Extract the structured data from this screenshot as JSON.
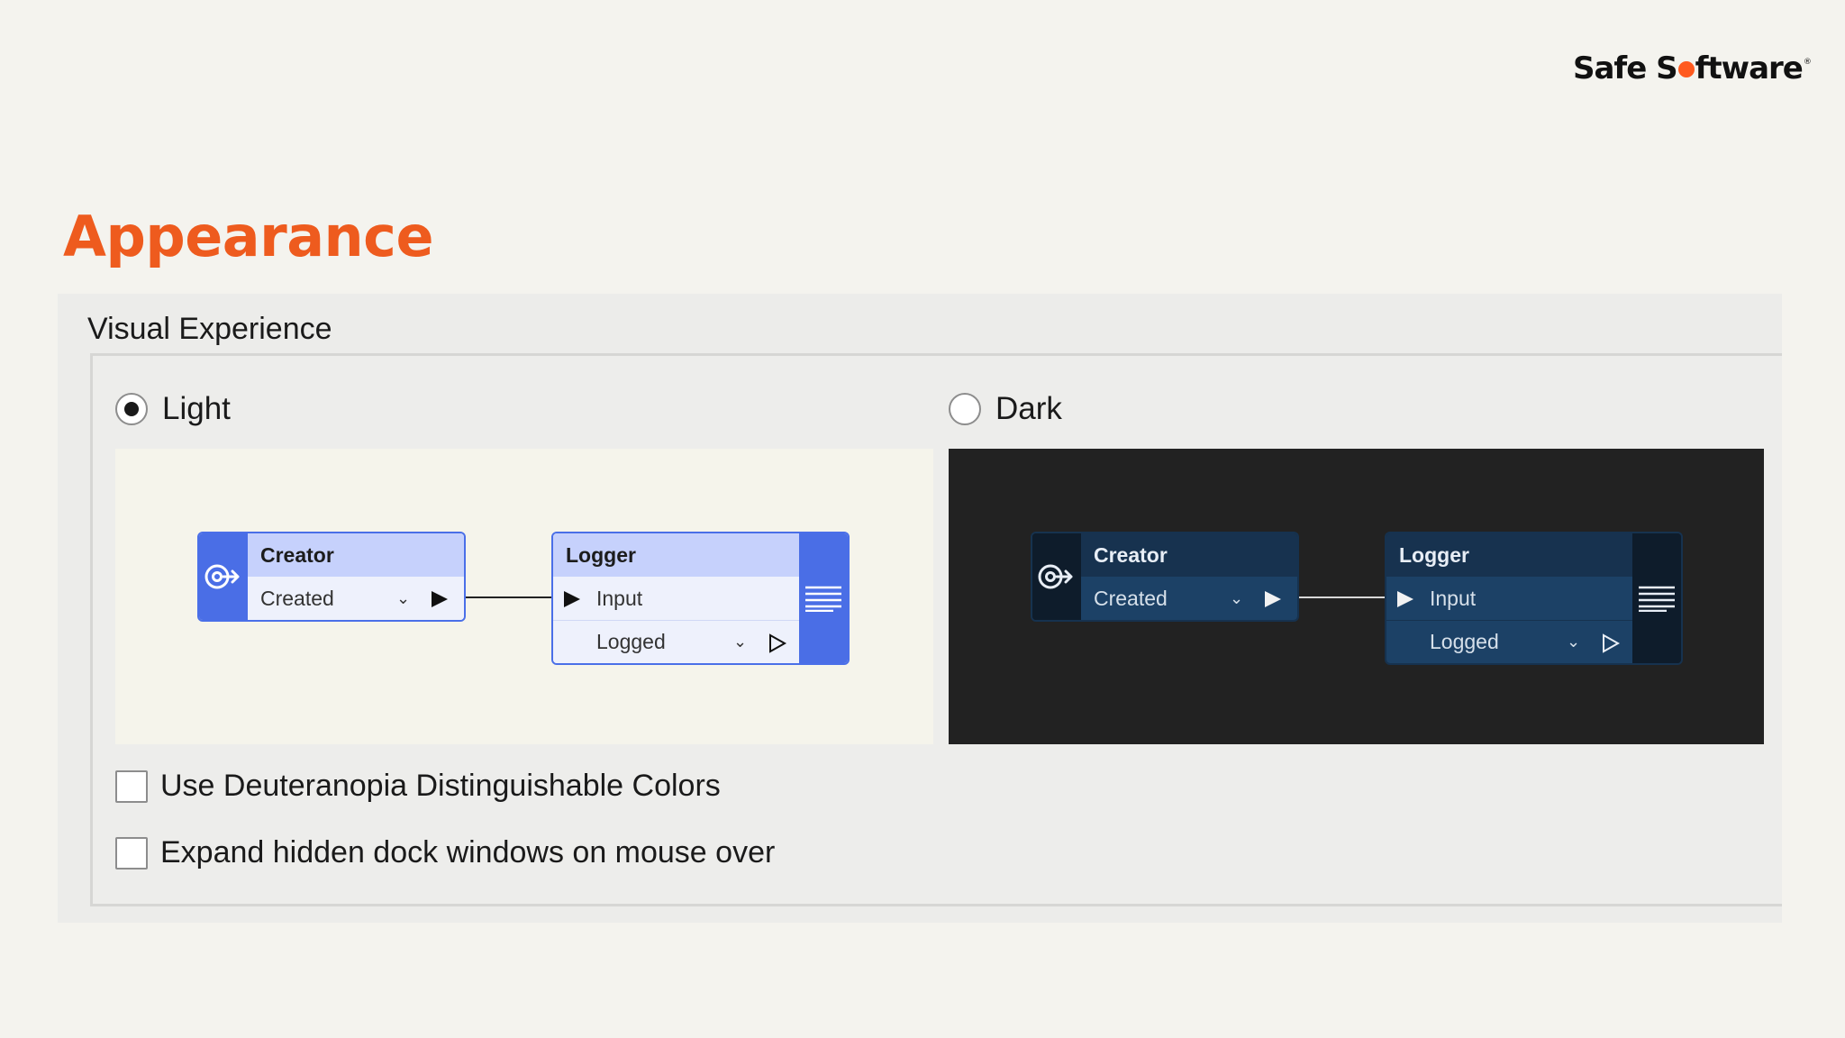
{
  "brand": {
    "logo_left": "Safe S",
    "logo_right": "ftware",
    "accent": "#ee5b1e"
  },
  "page": {
    "title": "Appearance"
  },
  "section": {
    "label": "Visual Experience"
  },
  "themes": {
    "light_label": "Light",
    "dark_label": "Dark",
    "selected": "light"
  },
  "preview": {
    "creator_title": "Creator",
    "creator_port": "Created",
    "logger_title": "Logger",
    "logger_input": "Input",
    "logger_output": "Logged"
  },
  "options": {
    "deuteranopia_label": "Use Deuteranopia Distinguishable Colors",
    "deuteranopia_checked": false,
    "expand_dock_label": "Expand hidden dock windows on mouse over",
    "expand_dock_checked": false
  },
  "icons": {
    "creator": "creator-icon",
    "logger": "logger-lines-icon",
    "chevron": "chevron-down-icon",
    "output_port": "output-triangle-icon"
  },
  "colors": {
    "light_node_accent": "#4a6ee6",
    "dark_node_bg": "#1c4166",
    "dark_preview_bg": "#222222",
    "light_preview_bg": "#f5f4eb"
  }
}
